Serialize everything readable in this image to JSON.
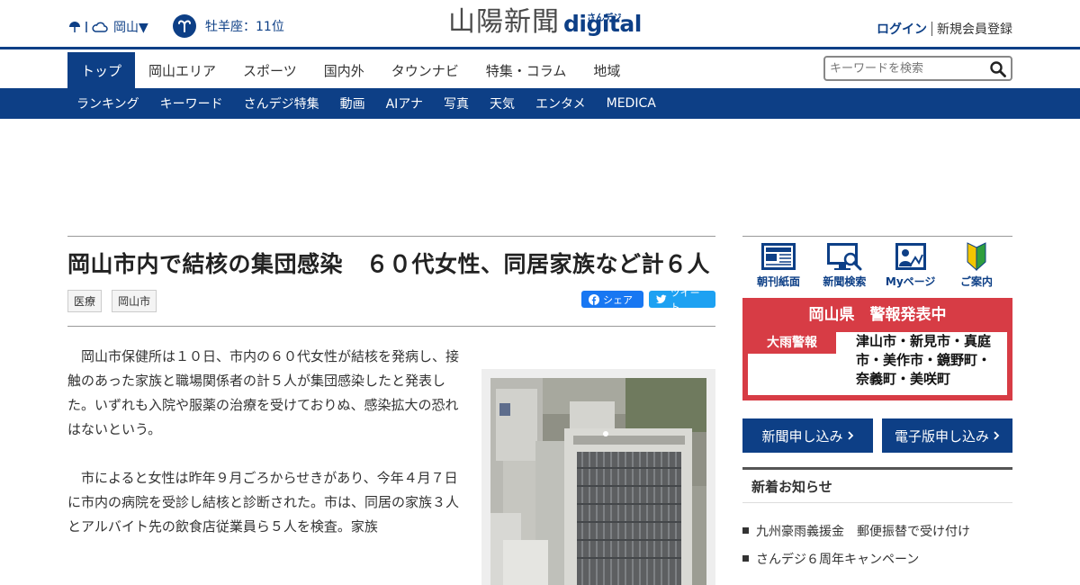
{
  "header": {
    "region": "岡山▼",
    "horoscope": "牡羊座：11位",
    "logo_jp": "山陽新聞",
    "logo_sub": "さんデジ",
    "logo_digital": "digital",
    "login": "ログイン",
    "register": "新規会員登録"
  },
  "nav": {
    "main": [
      "トップ",
      "岡山エリア",
      "スポーツ",
      "国内外",
      "タウンナビ",
      "特集・コラム",
      "地域"
    ],
    "sub": [
      "ランキング",
      "キーワード",
      "さんデジ特集",
      "動画",
      "AIアナ",
      "写真",
      "天気",
      "エンタメ",
      "MEDICA"
    ]
  },
  "search": {
    "placeholder": "キーワードを検索"
  },
  "article": {
    "title": "岡山市内で結核の集団感染　６０代女性、同居家族など計６人",
    "tags": [
      "医療",
      "岡山市"
    ],
    "share_fb": "シェア",
    "share_tw": "ツイート",
    "paragraphs": [
      "岡山市保健所は１０日、市内の６０代女性が結核を発病し、接触のあった家族と職場関係者の計５人が集団感染したと発表した。いずれも入院や服薬の治療を受けておりぬ、感染拡大の恐れはないという。",
      "市によると女性は昨年９月ごろからせきがあり、今年４月７日に市内の病院を受診し結核と診断された。市は、同居の家族３人とアルバイト先の飲食店従業員ら５人を検査。家族"
    ]
  },
  "sidebar": {
    "quick": [
      "朝刊紙面",
      "新聞検索",
      "Myページ",
      "ご案内"
    ],
    "alert_title": "岡山県　警報発表中",
    "alert_type": "大雨警報",
    "alert_areas": "津山市・新見市・真庭市・美作市・鏡野町・奈義町・美咲町",
    "apply_paper": "新聞申し込み",
    "apply_digital": "電子版申し込み",
    "news_head": "新着お知らせ",
    "news": [
      "九州豪雨義援金　郵便振替で受け付け",
      "さんデジ６周年キャンペーン"
    ]
  },
  "colors": {
    "brand": "#0d3f86",
    "alert": "#d73c45"
  },
  "icons": [
    "umbrella-icon",
    "cloud-icon",
    "aries-icon",
    "search-icon",
    "facebook-icon",
    "twitter-icon",
    "newspaper-icon",
    "monitor-search-icon",
    "mypage-icon",
    "beginner-mark-icon",
    "chevron-right-icon"
  ]
}
